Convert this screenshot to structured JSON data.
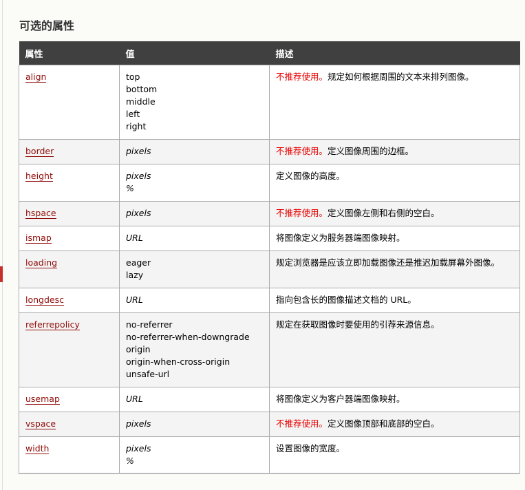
{
  "title": "可选的属性",
  "headers": [
    "属性",
    "值",
    "描述"
  ],
  "deprecated_label": "不推荐使用。",
  "rows": [
    {
      "attr": "align",
      "values": [
        "top",
        "bottom",
        "middle",
        "left",
        "right"
      ],
      "italic": false,
      "deprecated": true,
      "desc": "规定如何根据周围的文本来排列图像。"
    },
    {
      "attr": "border",
      "values": [
        "pixels"
      ],
      "italic": true,
      "deprecated": true,
      "desc": "定义图像周围的边框。"
    },
    {
      "attr": "height",
      "values": [
        "pixels",
        "%"
      ],
      "italic": true,
      "deprecated": false,
      "desc": "定义图像的高度。"
    },
    {
      "attr": "hspace",
      "values": [
        "pixels"
      ],
      "italic": true,
      "deprecated": true,
      "desc": "定义图像左侧和右侧的空白。"
    },
    {
      "attr": "ismap",
      "values": [
        "URL"
      ],
      "italic": true,
      "deprecated": false,
      "desc": "将图像定义为服务器端图像映射。"
    },
    {
      "attr": "loading",
      "values": [
        "eager",
        "lazy"
      ],
      "italic": false,
      "deprecated": false,
      "desc": "规定浏览器是应该立即加载图像还是推迟加载屏幕外图像。"
    },
    {
      "attr": "longdesc",
      "values": [
        "URL"
      ],
      "italic": true,
      "deprecated": false,
      "desc": "指向包含长的图像描述文档的 URL。"
    },
    {
      "attr": "referrepolicy",
      "values": [
        "no-referrer",
        "no-referrer-when-downgrade",
        "origin",
        "origin-when-cross-origin",
        "unsafe-url"
      ],
      "italic": false,
      "deprecated": false,
      "desc": "规定在获取图像时要使用的引荐来源信息。"
    },
    {
      "attr": "usemap",
      "values": [
        "URL"
      ],
      "italic": true,
      "deprecated": false,
      "desc": "将图像定义为客户器端图像映射。"
    },
    {
      "attr": "vspace",
      "values": [
        "pixels"
      ],
      "italic": true,
      "deprecated": true,
      "desc": "定义图像顶部和底部的空白。"
    },
    {
      "attr": "width",
      "values": [
        "pixels",
        "%"
      ],
      "italic": true,
      "deprecated": false,
      "desc": "设置图像的宽度。"
    }
  ]
}
